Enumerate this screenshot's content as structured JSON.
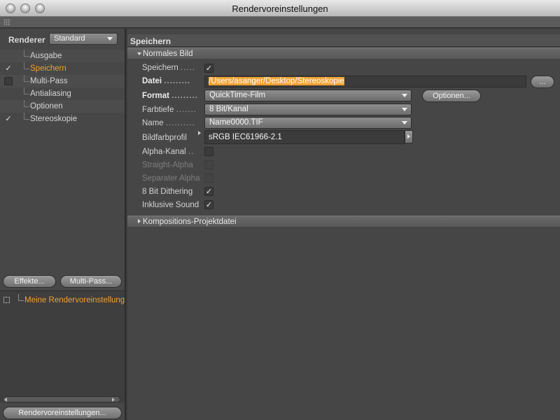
{
  "window": {
    "title": "Rendervoreinstellungen"
  },
  "left": {
    "renderer_label": "Renderer",
    "renderer_value": "Standard",
    "tree": [
      {
        "label": "Ausgabe",
        "check": ""
      },
      {
        "label": "Speichern",
        "check": "✓",
        "active": true
      },
      {
        "label": "Multi-Pass",
        "check": ""
      },
      {
        "label": "Antialiasing",
        "check": ""
      },
      {
        "label": "Optionen",
        "check": ""
      },
      {
        "label": "Stereoskopie",
        "check": "✓"
      }
    ],
    "effects_button": "Effekte...",
    "multipass_button": "Multi-Pass...",
    "preset_label": "Meine Rendervoreinstellung",
    "bottom_button": "Rendervoreinstellungen..."
  },
  "right": {
    "section_title": "Speichern",
    "group_normal": "Normales Bild",
    "group_comp": "Kompositions-Projektdatei",
    "fields": {
      "speichern": {
        "label": "Speichern",
        "dots": ".....",
        "check": "✓"
      },
      "datei": {
        "label": "Datei",
        "dots": ".........",
        "value": "/Users/asanger/Desktop/Stereoskopie",
        "button": "..."
      },
      "format": {
        "label": "Format",
        "dots": ".........",
        "value": "QuickTime-Film",
        "button": "Optionen..."
      },
      "farbtiefe": {
        "label": "Farbtiefe",
        "dots": ".......",
        "value": "8 Bit/Kanal"
      },
      "name": {
        "label": "Name",
        "dots": "..........",
        "value": "Name0000.TIF"
      },
      "bildfarbprofil": {
        "label": "Bildfarbprofil",
        "value": "sRGB IEC61966-2.1"
      },
      "alpha": {
        "label": "Alpha-Kanal",
        "dots": "..",
        "check": ""
      },
      "straight": {
        "label": "Straight-Alpha",
        "check": ""
      },
      "separater": {
        "label": "Separater Alpha",
        "check": ""
      },
      "dithering": {
        "label": "8 Bit Dithering",
        "check": "✓"
      },
      "sound": {
        "label": "Inklusive Sound",
        "check": "✓"
      }
    }
  }
}
